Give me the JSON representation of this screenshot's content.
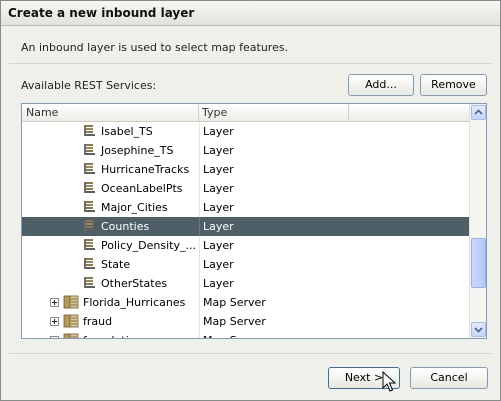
{
  "dialog": {
    "title": "Create a new inbound layer",
    "description": "An inbound layer is  used to select map features.",
    "available_label": "Available REST Services:"
  },
  "buttons": {
    "add": "Add...",
    "remove": "Remove",
    "next": "Next >",
    "cancel": "Cancel"
  },
  "table": {
    "columns": [
      "Name",
      "Type"
    ],
    "rows": [
      {
        "name": "Isabel_TS",
        "type": "Layer",
        "icon": "layer-icon",
        "selected": false
      },
      {
        "name": "Josephine_TS",
        "type": "Layer",
        "icon": "layer-icon",
        "selected": false
      },
      {
        "name": "HurricaneTracks",
        "type": "Layer",
        "icon": "layer-icon",
        "selected": false
      },
      {
        "name": "OceanLabelPts",
        "type": "Layer",
        "icon": "layer-icon",
        "selected": false
      },
      {
        "name": "Major_Cities",
        "type": "Layer",
        "icon": "layer-icon",
        "selected": false
      },
      {
        "name": "Counties",
        "type": "Layer",
        "icon": "layer-icon",
        "selected": true
      },
      {
        "name": "Policy_Density_...",
        "type": "Layer",
        "icon": "layer-icon",
        "selected": false
      },
      {
        "name": "State",
        "type": "Layer",
        "icon": "layer-icon",
        "selected": false
      },
      {
        "name": "OtherStates",
        "type": "Layer",
        "icon": "layer-icon",
        "selected": false
      },
      {
        "name": "Florida_Hurricanes",
        "type": "Map Server",
        "icon": "map-server-icon",
        "selected": false
      },
      {
        "name": "fraud",
        "type": "Map Server",
        "icon": "map-server-icon",
        "selected": false
      },
      {
        "name": "foundation",
        "type": "Map Server",
        "icon": "map-server-icon",
        "selected": false
      }
    ]
  },
  "colors": {
    "selected_row": "#4f5f68",
    "dialog_bg": "#f0f0ea",
    "border": "#7f9db9"
  }
}
